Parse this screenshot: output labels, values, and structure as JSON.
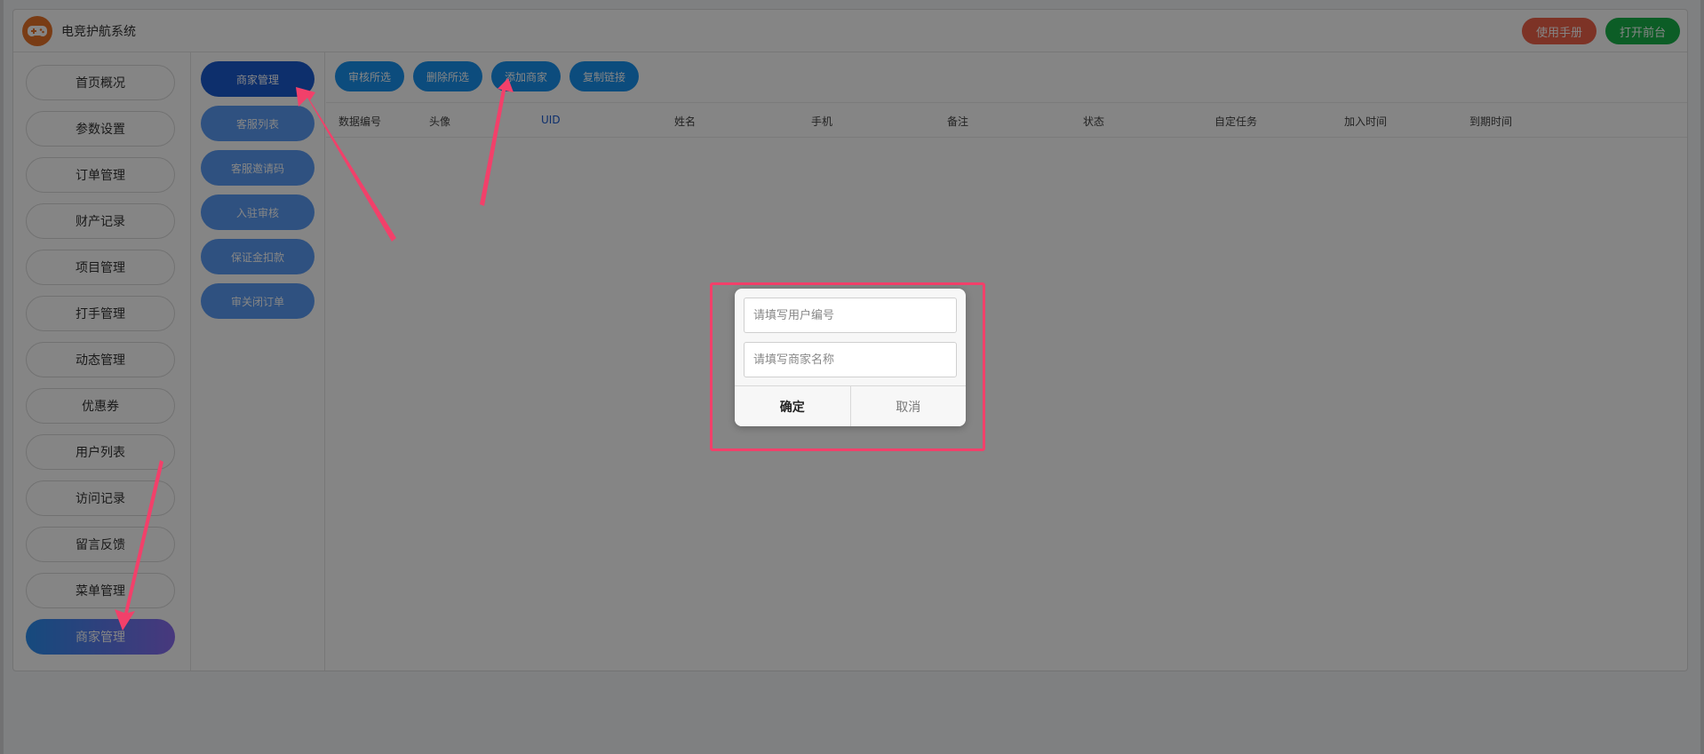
{
  "app": {
    "title": "电竞护航系统",
    "logo_icon": "gamepad-icon",
    "manual_button": "使用手册",
    "front_button": "打开前台",
    "colors": {
      "manual": "#f0624a",
      "front": "#17b24a",
      "accent": "#1893f0"
    }
  },
  "sidebar": {
    "items": [
      {
        "label": "首页概况"
      },
      {
        "label": "参数设置"
      },
      {
        "label": "订单管理"
      },
      {
        "label": "财产记录"
      },
      {
        "label": "项目管理"
      },
      {
        "label": "打手管理"
      },
      {
        "label": "动态管理"
      },
      {
        "label": "优惠券"
      },
      {
        "label": "用户列表"
      },
      {
        "label": "访问记录"
      },
      {
        "label": "留言反馈"
      },
      {
        "label": "菜单管理"
      },
      {
        "label": "商家管理",
        "active": true
      }
    ]
  },
  "submenu": {
    "items": [
      {
        "label": "商家管理",
        "active": true
      },
      {
        "label": "客服列表"
      },
      {
        "label": "客服邀请码"
      },
      {
        "label": "入驻审核"
      },
      {
        "label": "保证金扣款"
      },
      {
        "label": "审关闭订单"
      }
    ]
  },
  "toolbar": {
    "approve": "审核所选",
    "delete": "删除所选",
    "add": "添加商家",
    "copy": "复制链接"
  },
  "table": {
    "columns": [
      "数据编号",
      "头像",
      "UID",
      "姓名",
      "手机",
      "备注",
      "状态",
      "自定任务",
      "加入时间",
      "到期时间"
    ]
  },
  "dialog": {
    "user_id_placeholder": "请填写用户编号",
    "merchant_name_placeholder": "请填写商家名称",
    "confirm": "确定",
    "cancel": "取消"
  }
}
